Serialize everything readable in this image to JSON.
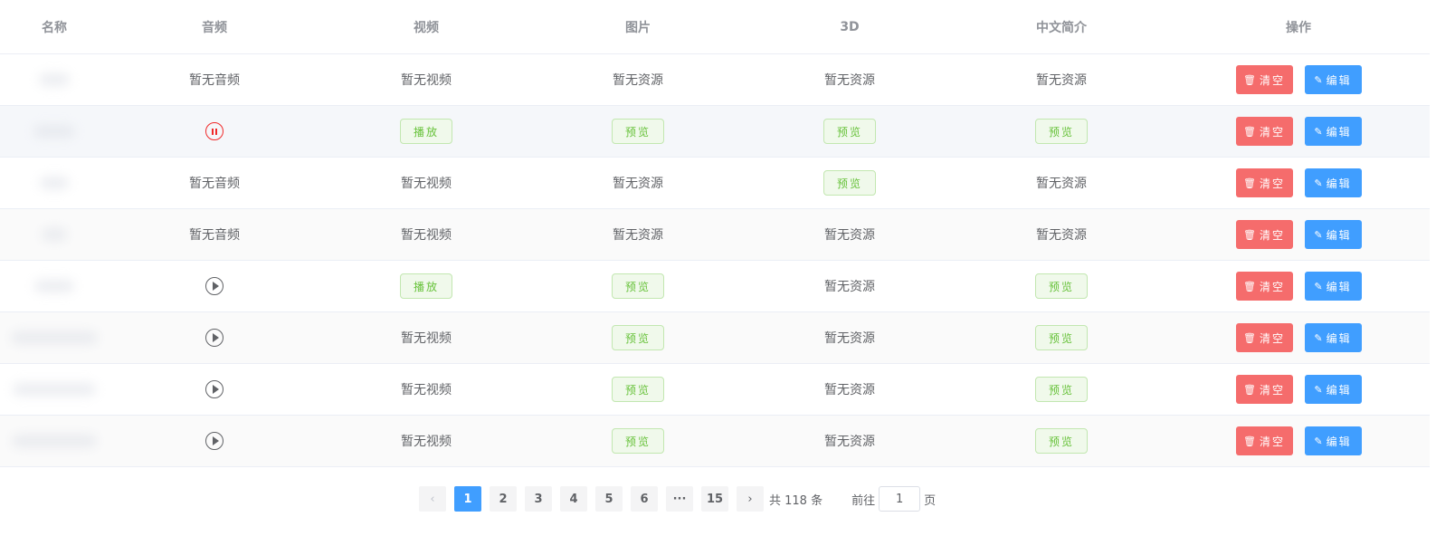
{
  "headers": {
    "name": "名称",
    "audio": "音频",
    "video": "视频",
    "image": "图片",
    "model3d": "3D",
    "intro": "中文简介",
    "ops": "操作"
  },
  "labels": {
    "no_audio": "暂无音频",
    "no_video": "暂无视频",
    "no_resource": "暂无资源",
    "play": "播放",
    "preview": "预览",
    "clear": "清空",
    "edit": "编辑"
  },
  "rows": [
    {
      "audio": "none",
      "video": "none",
      "image": "none",
      "model3d": "none",
      "intro": "none"
    },
    {
      "audio": "pause",
      "video": "play",
      "image": "preview",
      "model3d": "preview",
      "intro": "preview"
    },
    {
      "audio": "none",
      "video": "none",
      "image": "none",
      "model3d": "preview",
      "intro": "none"
    },
    {
      "audio": "none",
      "video": "none",
      "image": "none",
      "model3d": "none",
      "intro": "none"
    },
    {
      "audio": "play",
      "video": "play",
      "image": "preview",
      "model3d": "none",
      "intro": "preview"
    },
    {
      "audio": "play",
      "video": "none",
      "image": "preview",
      "model3d": "none",
      "intro": "preview"
    },
    {
      "audio": "play",
      "video": "none",
      "image": "preview",
      "model3d": "none",
      "intro": "preview"
    },
    {
      "audio": "play",
      "video": "none",
      "image": "preview",
      "model3d": "none",
      "intro": "preview"
    }
  ],
  "pagination": {
    "prev_icon": "chevron-left-icon",
    "next_icon": "chevron-right-icon",
    "pages": [
      "1",
      "2",
      "3",
      "4",
      "5",
      "6",
      "···",
      "15"
    ],
    "current_page": "1",
    "total_text": "共 118 条",
    "goto_prefix": "前往",
    "goto_value": "1",
    "goto_suffix": "页"
  },
  "colors": {
    "danger": "#f56c6c",
    "primary": "#409eff",
    "success": "#67c23a",
    "pause": "#f02a2a"
  }
}
